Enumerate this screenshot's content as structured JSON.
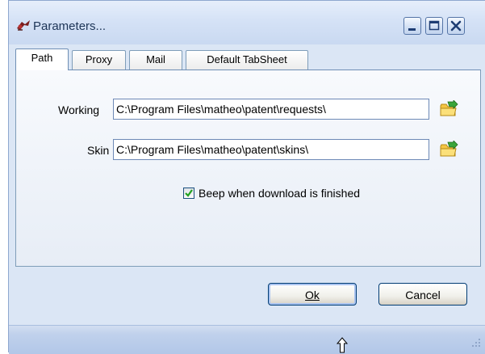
{
  "window": {
    "title": "Parameters...",
    "controls": [
      "minimize-icon",
      "maximize-icon",
      "close-icon"
    ]
  },
  "tabs": [
    {
      "label": "Path",
      "active": true
    },
    {
      "label": "Proxy",
      "active": false
    },
    {
      "label": "Mail",
      "active": false
    },
    {
      "label": "Default TabSheet",
      "active": false
    }
  ],
  "path_tab": {
    "working": {
      "label": "Working",
      "value": "C:\\Program Files\\matheo\\patent\\requests\\"
    },
    "skin": {
      "label": "Skin",
      "value": "C:\\Program Files\\matheo\\patent\\skins\\"
    },
    "beep": {
      "label": "Beep when download is finished",
      "checked": true
    }
  },
  "buttons": {
    "ok_label": "Ok",
    "cancel_label": "Cancel"
  },
  "colors": {
    "window_bg": "#dbe6f5",
    "accent_border": "#003c74",
    "folder_icon": "#f5c542",
    "arrow_icon": "#3aa53a"
  }
}
